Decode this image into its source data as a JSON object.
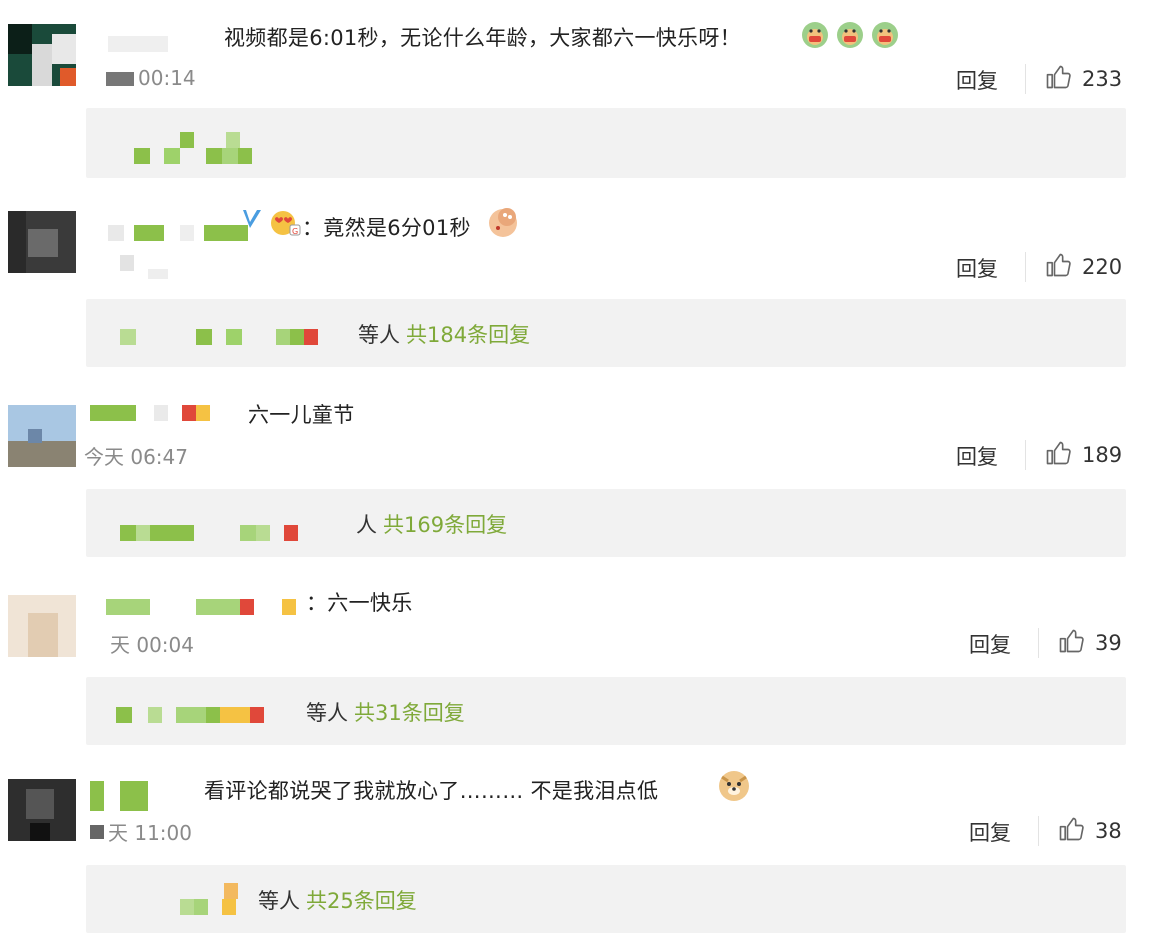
{
  "reply_label": "回复",
  "comments": [
    {
      "text": "视频都是6:01秒，无论什么年龄，大家都六一快乐呀！",
      "time": "00:14",
      "likes": "233",
      "reply_summary": null
    },
    {
      "text": "：竟然是6分01秒",
      "time": "",
      "likes": "220",
      "reply_summary": {
        "who": "等人",
        "count": "共184条回复"
      }
    },
    {
      "text": "六一儿童节",
      "time": "今天 06:47",
      "likes": "189",
      "reply_summary": {
        "who": "人",
        "count": "共169条回复"
      }
    },
    {
      "text": "：六一快乐",
      "time": "天 00:04",
      "likes": "39",
      "reply_summary": {
        "who": "等人",
        "count": "共31条回复"
      }
    },
    {
      "text": "看评论都说哭了我就放心了……… 不是我泪点低",
      "time": "天 11:00",
      "likes": "38",
      "reply_summary": {
        "who": "等人",
        "count": "共25条回复"
      }
    }
  ],
  "colors": {
    "accent_green": "#7fa939",
    "reply_box_bg": "#f2f2f2",
    "time_gray": "#8a8a8a"
  },
  "icons": [
    "thumbs-up-icon",
    "clap-emoji-icon",
    "heart-eyes-emoji-icon",
    "facepalm-emoji-icon",
    "doge-emoji-icon"
  ]
}
